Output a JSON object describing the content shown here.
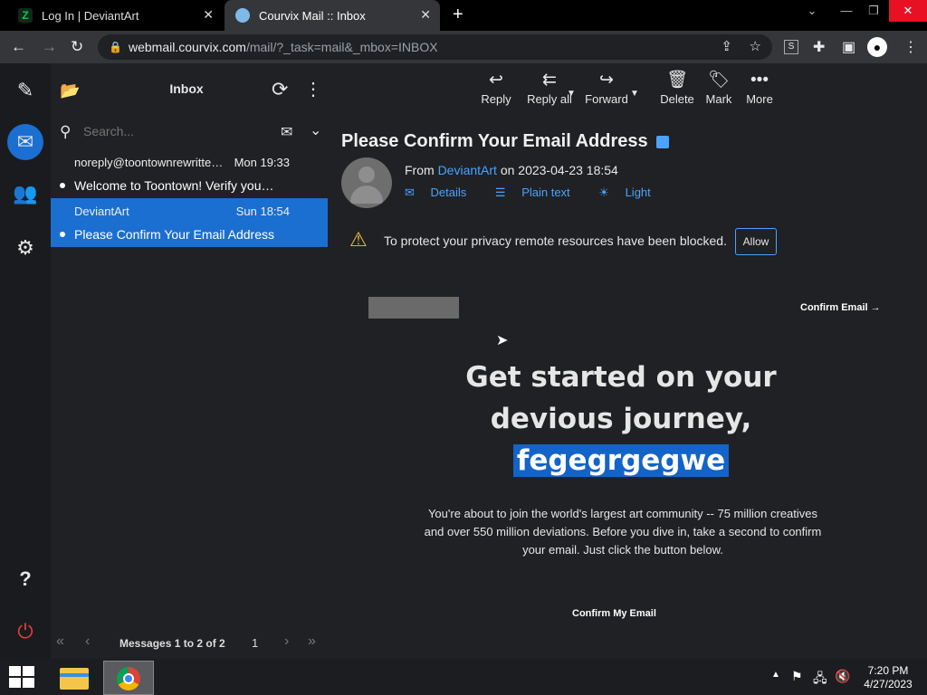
{
  "browser": {
    "tabs": [
      {
        "title": "Log In | DeviantArt",
        "active": false
      },
      {
        "title": "Courvix Mail :: Inbox",
        "active": true
      }
    ],
    "url": {
      "host": "webmail.courvix.com",
      "path": "/mail/?_task=mail&_mbox=INBOX"
    },
    "colors": {
      "tabbar_bg": "#000000",
      "toolbar_bg": "#35363a",
      "close_button": "#e81123"
    }
  },
  "sidebar": {
    "icons": [
      "compose-icon",
      "mail-icon",
      "contacts-icon",
      "settings-icon",
      "help-icon",
      "logout-icon"
    ]
  },
  "message_list": {
    "folder_title": "Inbox",
    "search_placeholder": "Search...",
    "messages": [
      {
        "from": "noreply@toontownrewritten.com",
        "date": "Mon 19:33",
        "subject": "Welcome to Toontown! Verify your email",
        "selected": false
      },
      {
        "from": "DeviantArt",
        "date": "Sun 18:54",
        "subject": "Please Confirm Your Email Address",
        "selected": true
      }
    ],
    "pager": {
      "label": "Messages 1 to 2 of 2",
      "page": "1"
    }
  },
  "toolbar": {
    "reply": "Reply",
    "reply_all": "Reply all",
    "forward": "Forward",
    "delete": "Delete",
    "mark": "Mark",
    "more": "More"
  },
  "message": {
    "subject": "Please Confirm Your Email Address",
    "from_prefix": "From",
    "from_name": "DeviantArt",
    "date_prefix": "on",
    "date": "2023-04-23 18:54",
    "links": {
      "details": "Details",
      "plain_text": "Plain text",
      "light": "Light"
    },
    "remote_warning": "To protect your privacy remote resources have been blocked.",
    "allow_label": "Allow",
    "body": {
      "confirm_top": "Confirm Email →",
      "headline_line1": "Get started on your",
      "headline_line2": "devious journey,",
      "username": "fegegrgegwe",
      "blurb": "You're about to join the world's largest art community -- 75 million creatives and over 550 million deviations. Before you dive in, take a second to confirm your email. Just click the button below.",
      "confirm_bottom": "Confirm My Email"
    }
  },
  "taskbar": {
    "time": "7:20 PM",
    "date": "4/27/2023"
  },
  "colors": {
    "accent": "#1b6fd1",
    "link": "#4aa3ff",
    "app_bg": "#1f2124",
    "warning": "#f2c233"
  }
}
